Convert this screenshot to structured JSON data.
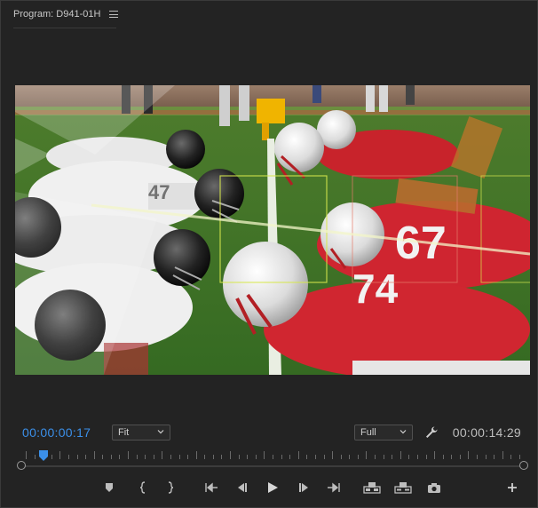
{
  "panel": {
    "title": "Program: D941-01H"
  },
  "monitor": {
    "current_timecode": "00:00:00:17",
    "duration_timecode": "00:00:14:29",
    "zoom": "Fit",
    "resolution": "Full",
    "playhead_position": 0.027
  },
  "colors": {
    "accent": "#3b8fe8",
    "background": "#232323",
    "text": "#bdbdbd"
  },
  "transport": {
    "buttons": [
      "add-marker-icon",
      "mark-in-icon",
      "mark-out-icon",
      "go-to-in-icon",
      "step-back-icon",
      "play-icon",
      "step-forward-icon",
      "go-to-out-icon",
      "lift-icon",
      "extract-icon",
      "export-frame-icon"
    ],
    "add_button": "plus-icon"
  },
  "image": {
    "description_icon": "football-line-of-scrimmage-frame",
    "jersey_numbers": [
      "67",
      "74"
    ]
  }
}
